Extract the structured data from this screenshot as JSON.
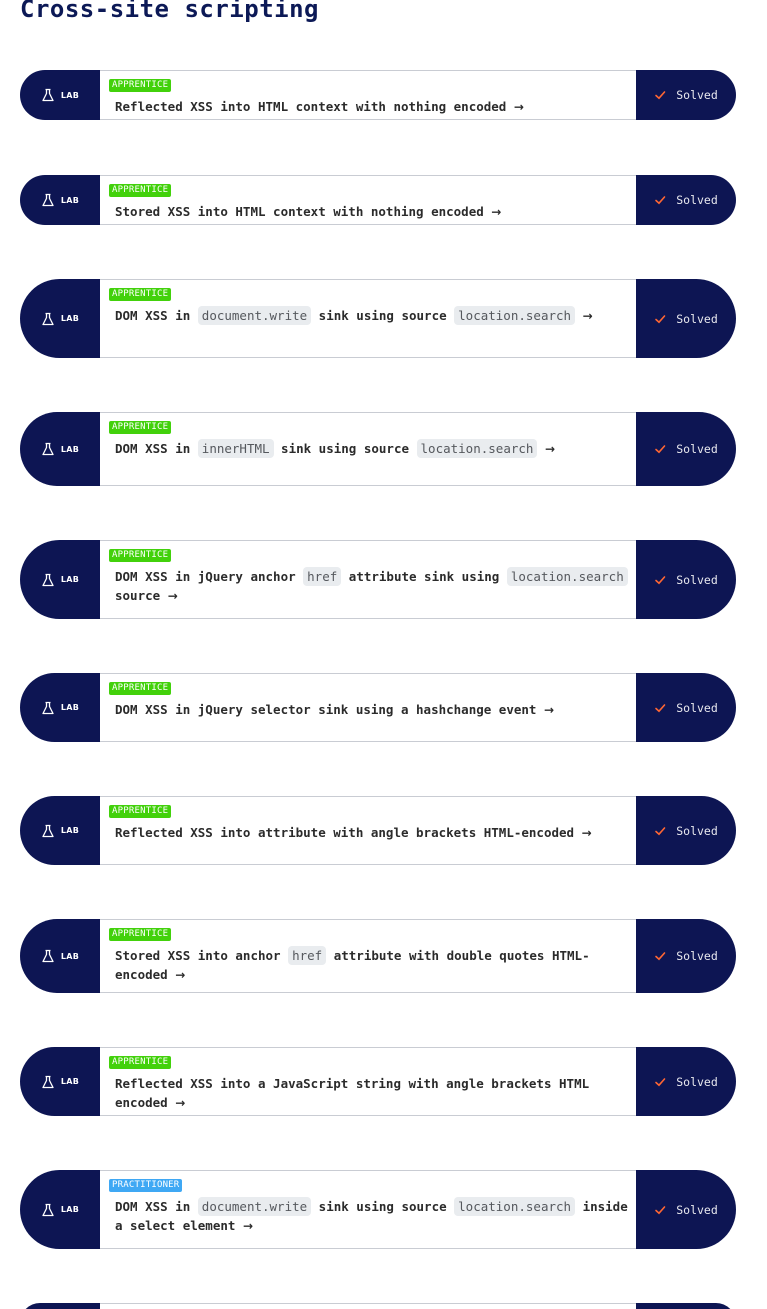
{
  "page": {
    "title": "Cross-site scripting"
  },
  "colors": {
    "navy": "#0d1553",
    "apprentice": "#42d10b",
    "practitioner": "#3fa8f4",
    "check": "#ff6633"
  },
  "labs": [
    {
      "tag": "LAB",
      "level": "APPRENTICE",
      "level_color": "#42d10b",
      "title_parts": [
        {
          "text": "Reflected XSS into HTML context with nothing encoded"
        }
      ],
      "arrow": "→",
      "status": "Solved",
      "status_icon": "check-icon"
    },
    {
      "tag": "LAB",
      "level": "APPRENTICE",
      "level_color": "#42d10b",
      "title_parts": [
        {
          "text": "Stored XSS into HTML context with nothing encoded"
        }
      ],
      "arrow": "→",
      "status": "Solved",
      "status_icon": "check-icon"
    },
    {
      "tag": "LAB",
      "level": "APPRENTICE",
      "level_color": "#42d10b",
      "title_parts": [
        {
          "text": "DOM XSS in "
        },
        {
          "code": "document.write"
        },
        {
          "text": " sink using source "
        },
        {
          "code": "location.search"
        }
      ],
      "arrow": "→",
      "status": "Solved",
      "status_icon": "check-icon"
    },
    {
      "tag": "LAB",
      "level": "APPRENTICE",
      "level_color": "#42d10b",
      "title_parts": [
        {
          "text": "DOM XSS in "
        },
        {
          "code": "innerHTML"
        },
        {
          "text": " sink using source "
        },
        {
          "code": "location.search"
        }
      ],
      "arrow": "→",
      "status": "Solved",
      "status_icon": "check-icon"
    },
    {
      "tag": "LAB",
      "level": "APPRENTICE",
      "level_color": "#42d10b",
      "title_parts": [
        {
          "text": "DOM XSS in jQuery anchor "
        },
        {
          "code": "href"
        },
        {
          "text": " attribute sink using "
        },
        {
          "code": "location.search"
        },
        {
          "text": " source"
        }
      ],
      "arrow": "→",
      "status": "Solved",
      "status_icon": "check-icon"
    },
    {
      "tag": "LAB",
      "level": "APPRENTICE",
      "level_color": "#42d10b",
      "title_parts": [
        {
          "text": "DOM XSS in jQuery selector sink using a hashchange event"
        }
      ],
      "arrow": "→",
      "status": "Solved",
      "status_icon": "check-icon"
    },
    {
      "tag": "LAB",
      "level": "APPRENTICE",
      "level_color": "#42d10b",
      "title_parts": [
        {
          "text": "Reflected XSS into attribute with angle brackets HTML-encoded"
        }
      ],
      "arrow": "→",
      "status": "Solved",
      "status_icon": "check-icon"
    },
    {
      "tag": "LAB",
      "level": "APPRENTICE",
      "level_color": "#42d10b",
      "title_parts": [
        {
          "text": "Stored XSS into anchor "
        },
        {
          "code": "href"
        },
        {
          "text": " attribute with double quotes HTML-encoded"
        }
      ],
      "arrow": "→",
      "status": "Solved",
      "status_icon": "check-icon"
    },
    {
      "tag": "LAB",
      "level": "APPRENTICE",
      "level_color": "#42d10b",
      "title_parts": [
        {
          "text": "Reflected XSS into a JavaScript string with angle brackets HTML encoded"
        }
      ],
      "arrow": "→",
      "status": "Solved",
      "status_icon": "check-icon"
    },
    {
      "tag": "LAB",
      "level": "PRACTITIONER",
      "level_color": "#3fa8f4",
      "title_parts": [
        {
          "text": "DOM XSS in "
        },
        {
          "code": "document.write"
        },
        {
          "text": " sink using source "
        },
        {
          "code": "location.search"
        },
        {
          "text": " inside a select element"
        }
      ],
      "arrow": "→",
      "status": "Solved",
      "status_icon": "check-icon"
    }
  ]
}
